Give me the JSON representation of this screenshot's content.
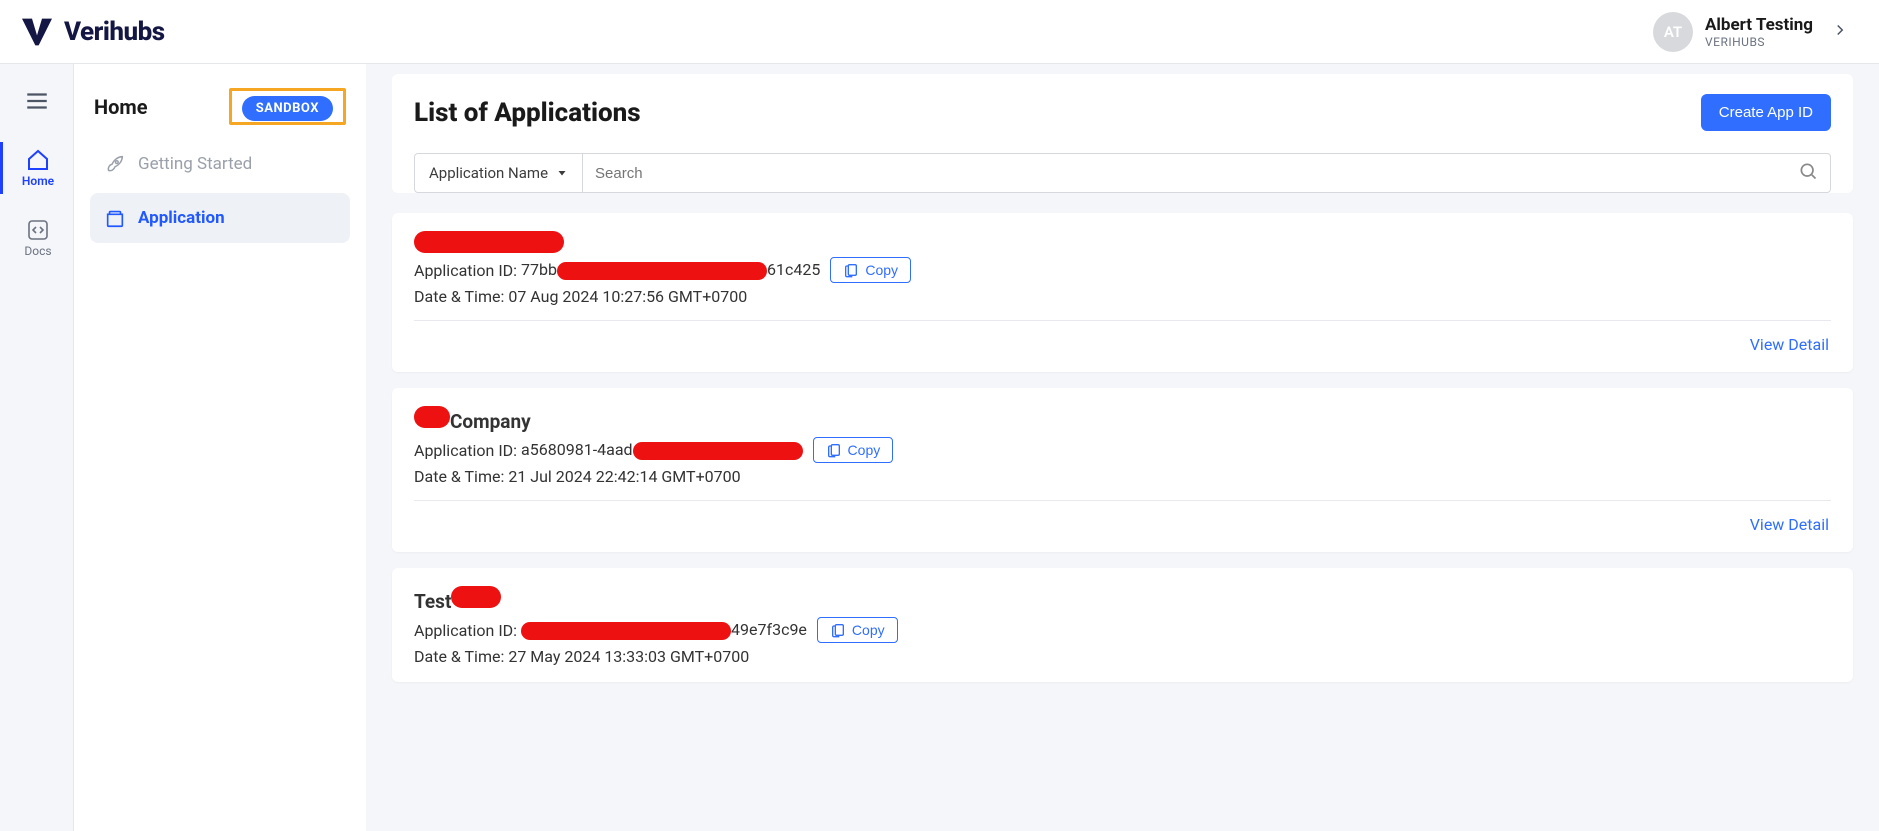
{
  "header": {
    "brand": "Verihubs",
    "user": {
      "initials": "AT",
      "name": "Albert Testing",
      "org": "VERIHUBS"
    }
  },
  "rail": {
    "home": "Home",
    "docs": "Docs"
  },
  "sidebar": {
    "title": "Home",
    "sandbox_badge": "SANDBOX",
    "items": {
      "getting_started": "Getting Started",
      "application": "Application"
    }
  },
  "main": {
    "title": "List of Applications",
    "create_button": "Create App ID",
    "filter_label": "Application Name",
    "search_placeholder": "Search",
    "labels": {
      "app_id": "Application ID:",
      "date_time": "Date & Time:",
      "copy": "Copy",
      "view_detail": "View Detail"
    },
    "apps": [
      {
        "name_prefix_redact_w": 150,
        "name_suffix": "",
        "id_prefix": "77bb",
        "id_redact_w": 210,
        "id_suffix": "61c425",
        "datetime": "07 Aug 2024 10:27:56 GMT+0700"
      },
      {
        "name_prefix_redact_w": 36,
        "name_suffix": " Company",
        "id_prefix": "a5680981-4aad",
        "id_redact_w": 170,
        "id_suffix": "",
        "datetime": "21 Jul 2024 22:42:14 GMT+0700"
      },
      {
        "name_literal_prefix": "Test",
        "name_prefix_redact_w": 50,
        "name_suffix": "",
        "id_prefix": "",
        "id_redact_w": 210,
        "id_suffix": "49e7f3c9e",
        "datetime": "27 May 2024 13:33:03 GMT+0700"
      }
    ]
  }
}
